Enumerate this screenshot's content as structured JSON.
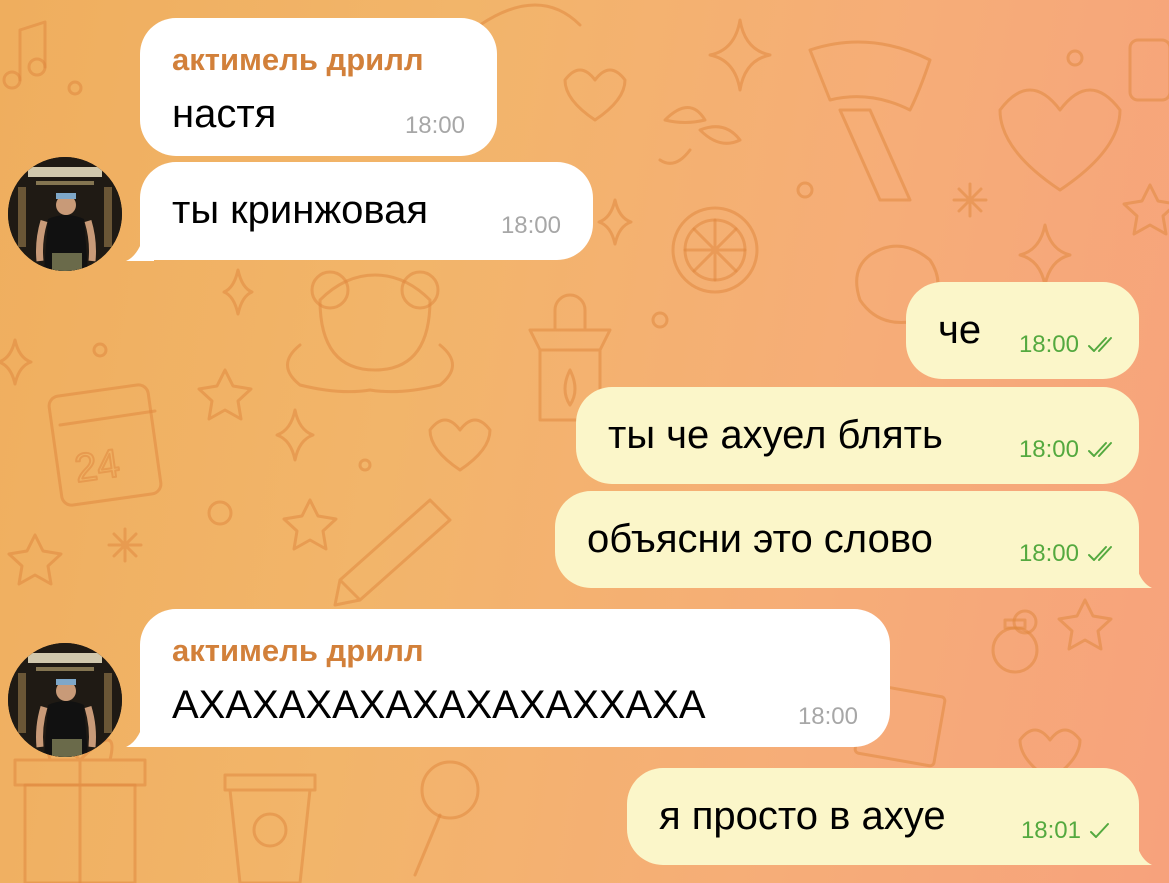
{
  "chat": {
    "messages": [
      {
        "sender": "актимель дрилл",
        "text": "настя",
        "time": "18:00"
      },
      {
        "text": "ты кринжовая",
        "time": "18:00"
      },
      {
        "text": "че",
        "time": "18:00",
        "status": "read"
      },
      {
        "text": "ты че ахуел блять",
        "time": "18:00",
        "status": "read"
      },
      {
        "text": "объясни это слово",
        "time": "18:00",
        "status": "read"
      },
      {
        "sender": "актимель дрилл",
        "text": "АХАХАХАХАХАХАХАХХАХА",
        "time": "18:00"
      },
      {
        "text": "я просто в ахуе",
        "time": "18:01",
        "status": "delivered"
      }
    ]
  },
  "colors": {
    "incoming_bubble": "#ffffff",
    "outgoing_bubble": "#fbf6c9",
    "sender_name": "#d2803a",
    "check_marks": "#54a93f"
  },
  "icons": {
    "read": "double-check-icon",
    "delivered": "single-check-icon"
  }
}
